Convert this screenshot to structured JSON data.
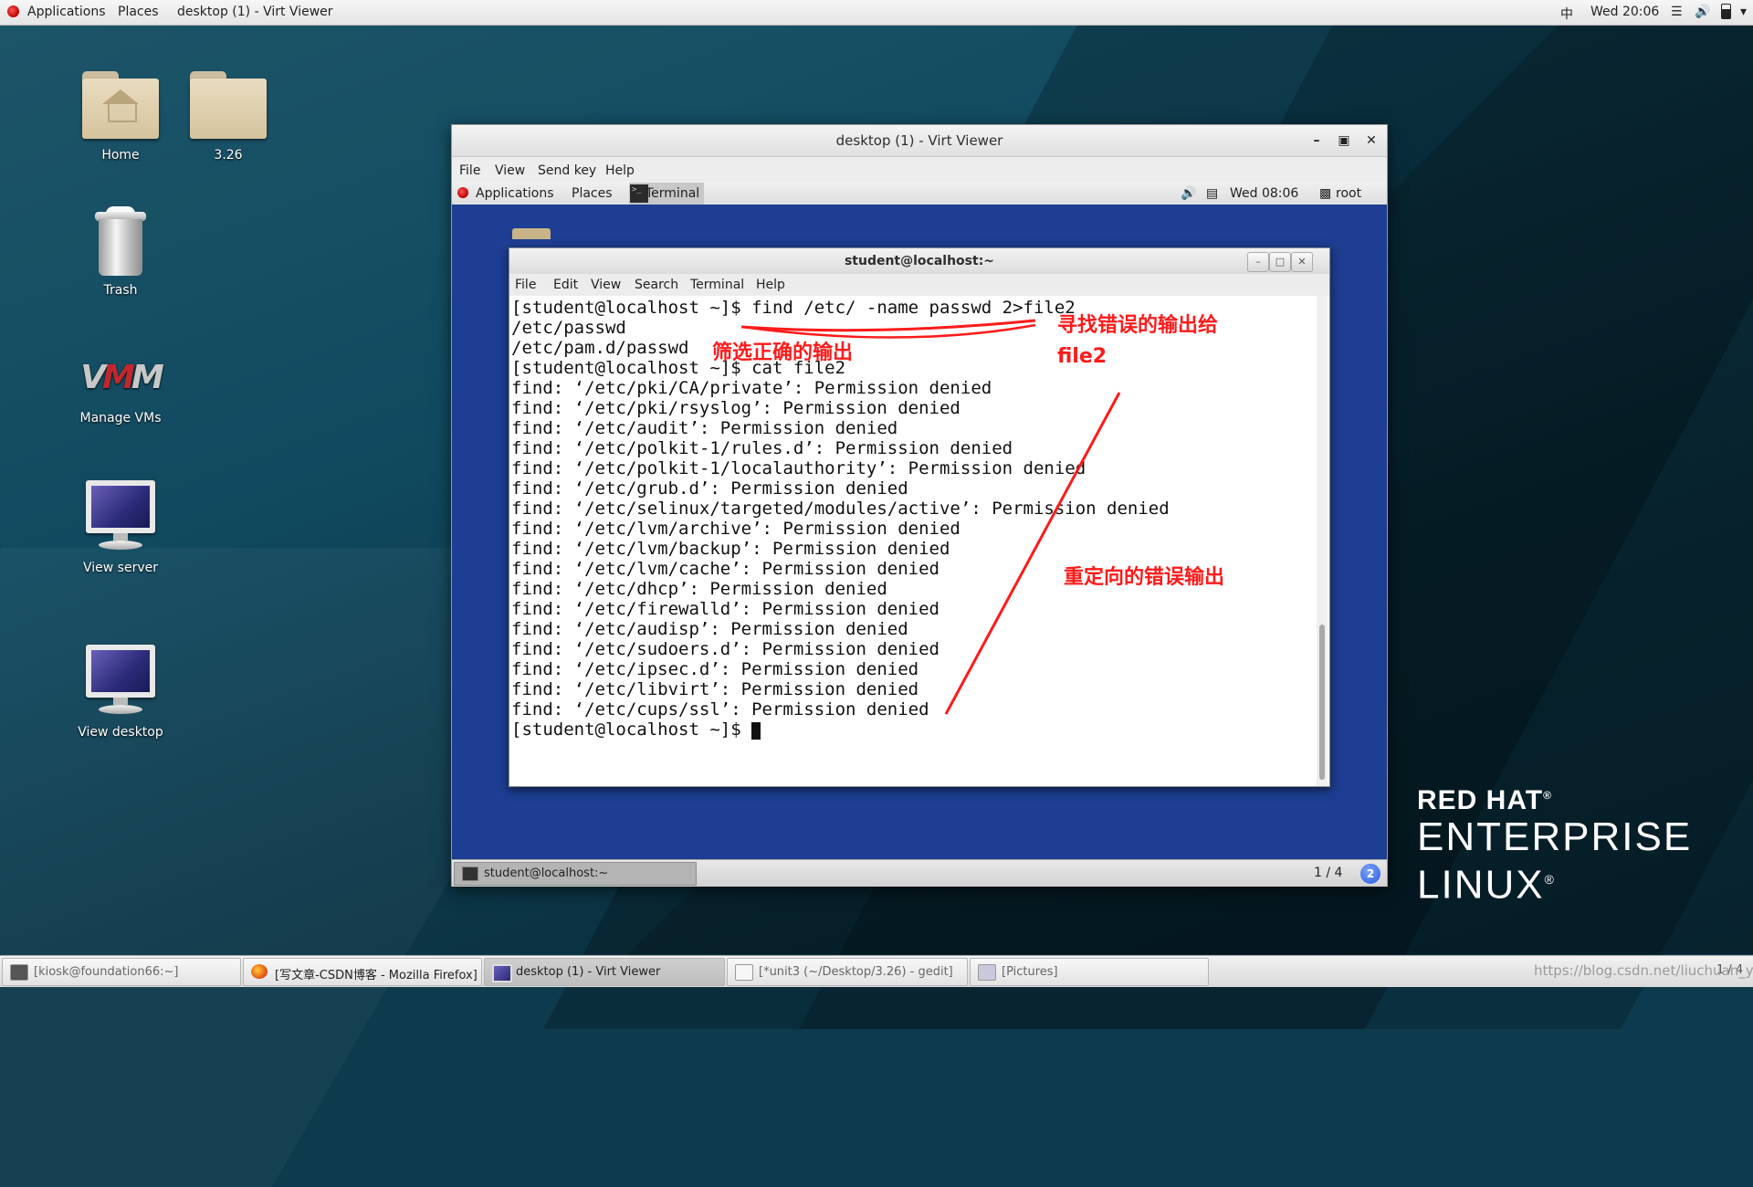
{
  "top_panel": {
    "applications": "Applications",
    "places": "Places",
    "window_title": "desktop (1) - Virt Viewer",
    "input_method": "中",
    "clock": "Wed 20:06"
  },
  "desktop_icons": [
    {
      "label": "Home"
    },
    {
      "label": "3.26"
    },
    {
      "label": "Trash"
    },
    {
      "label": "Manage VMs"
    },
    {
      "label": "View server"
    },
    {
      "label": "View desktop"
    }
  ],
  "brand": {
    "line1": "RED HAT",
    "line2": "ENTERPRISE",
    "line3": "LINUX",
    "reg": "®"
  },
  "virt_viewer": {
    "title": "desktop (1) - Virt Viewer",
    "menu": [
      "File",
      "View",
      "Send key",
      "Help"
    ],
    "guest_panel": {
      "applications": "Applications",
      "places": "Places",
      "terminal": "Terminal",
      "clock": "Wed 08:06",
      "user": "root"
    },
    "terminal": {
      "title": "student@localhost:~",
      "menu": [
        "File",
        "Edit",
        "View",
        "Search",
        "Terminal",
        "Help"
      ],
      "lines": [
        "[student@localhost ~]$ find /etc/ -name passwd 2>file2",
        "/etc/passwd",
        "/etc/pam.d/passwd",
        "[student@localhost ~]$ cat file2",
        "find: ‘/etc/pki/CA/private’: Permission denied",
        "find: ‘/etc/pki/rsyslog’: Permission denied",
        "find: ‘/etc/audit’: Permission denied",
        "find: ‘/etc/polkit-1/rules.d’: Permission denied",
        "find: ‘/etc/polkit-1/localauthority’: Permission denied",
        "find: ‘/etc/grub.d’: Permission denied",
        "find: ‘/etc/selinux/targeted/modules/active’: Permission denied",
        "find: ‘/etc/lvm/archive’: Permission denied",
        "find: ‘/etc/lvm/backup’: Permission denied",
        "find: ‘/etc/lvm/cache’: Permission denied",
        "find: ‘/etc/dhcp’: Permission denied",
        "find: ‘/etc/firewalld’: Permission denied",
        "find: ‘/etc/audisp’: Permission denied",
        "find: ‘/etc/sudoers.d’: Permission denied",
        "find: ‘/etc/ipsec.d’: Permission denied",
        "find: ‘/etc/libvirt’: Permission denied",
        "find: ‘/etc/cups/ssl’: Permission denied"
      ],
      "prompt": "[student@localhost ~]$ "
    },
    "guest_taskbar": {
      "task": "student@localhost:~",
      "workspace": "1 / 4",
      "workspace_icon": "2"
    }
  },
  "annotations": {
    "a1": "寻找错误的输出给",
    "a2": "file2",
    "a3": "筛选正确的输出",
    "a4": "重定向的错误输出",
    "color": "#ff1a1a"
  },
  "taskbar": [
    {
      "label": "[kiosk@foundation66:~]",
      "icon": "terminal-icon"
    },
    {
      "label": "[写文章-CSDN博客 - Mozilla Firefox]",
      "icon": "firefox-icon"
    },
    {
      "label": "desktop (1) - Virt Viewer",
      "icon": "virt-viewer-icon",
      "active": true
    },
    {
      "label": "[*unit3 (~/Desktop/3.26) - gedit]",
      "icon": "gedit-icon"
    },
    {
      "label": "[Pictures]",
      "icon": "folder-icon"
    }
  ],
  "watermark": "https://blog.csdn.net/liuchuan_yin",
  "workspace_indicator": "1 / 4"
}
